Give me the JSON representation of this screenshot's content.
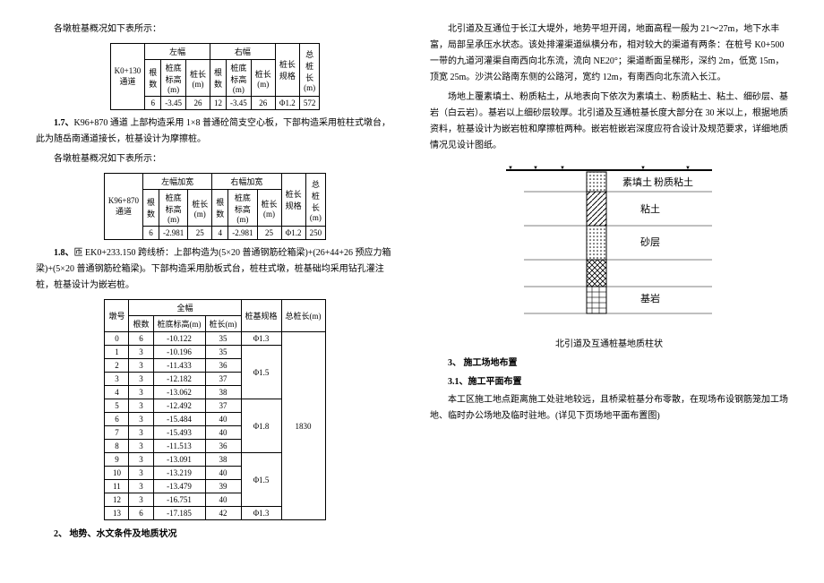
{
  "col1": {
    "intro1": "各墩桩基概况如下表所示：",
    "t1": {
      "row_label": "K0+130\n通道",
      "g1": "左幅",
      "g2": "右幅",
      "g3_a": "桩长\n规格",
      "g3_b": "总\n桩\n长\n(m)",
      "h1": "根\n数",
      "h2": "桩底\n标高\n(m)",
      "h3": "桩长\n(m)",
      "h4": "根\n数",
      "h5": "桩底\n标高\n(m)",
      "h6": "桩长\n(m)",
      "d1": "6",
      "d2": "-3.45",
      "d3": "26",
      "d4": "12",
      "d5": "-3.45",
      "d6": "26",
      "d7": "Φ1.2",
      "d8": "572"
    },
    "p17": "1.7、K96+870 通道 上部构造采用 1×8 普通砼简支空心板，下部构造采用桩柱式墩台，此为随岳南通道接长，桩基设计为摩擦桩。",
    "intro2": "各墩桩基概况如下表所示：",
    "t2": {
      "row_label": "K96+870\n通道",
      "g1": "左幅加宽",
      "g2": "右幅加宽",
      "g3_a": "桩长\n规格",
      "g3_b": "总\n桩\n长\n(m)",
      "h1": "根\n数",
      "h2": "桩底\n标高\n(m)",
      "h3": "桩长\n(m)",
      "h4": "根\n数",
      "h5": "桩底\n标高\n(m)",
      "h6": "桩长\n(m)",
      "d1": "6",
      "d2": "-2.981",
      "d3": "25",
      "d4": "4",
      "d5": "-2.981",
      "d6": "25",
      "d7": "Φ1.2",
      "d8": "250"
    },
    "p18": "1.8、匝 EK0+233.150 跨线桥：上部构造为(5×20 普通钢筋砼箱梁)+(26+44+26 预应力箱梁)+(5×20 普通钢筋砼箱梁)。下部构造采用肋板式台，桩柱式墩，桩基础均采用钻孔灌注桩，桩基设计为嵌岩桩。",
    "t3": {
      "h_pier": "墩号",
      "h_full": "全幅",
      "h_spec": "桩基规格",
      "h_total": "总桩长(m)",
      "sh1": "根数",
      "sh2": "桩底标高(m)",
      "sh3": "桩长(m)",
      "rows": [
        {
          "p": "0",
          "n": "6",
          "el": "-10.122",
          "len": "35",
          "spec": "Φ1.3"
        },
        {
          "p": "1",
          "n": "3",
          "el": "-10.196",
          "len": "35"
        },
        {
          "p": "2",
          "n": "3",
          "el": "-11.433",
          "len": "36"
        },
        {
          "p": "3",
          "n": "3",
          "el": "-12.182",
          "len": "37"
        },
        {
          "p": "4",
          "n": "3",
          "el": "-13.062",
          "len": "38"
        },
        {
          "p": "5",
          "n": "3",
          "el": "-12.492",
          "len": "37"
        },
        {
          "p": "6",
          "n": "3",
          "el": "-15.484",
          "len": "40"
        },
        {
          "p": "7",
          "n": "3",
          "el": "-15.493",
          "len": "40"
        },
        {
          "p": "8",
          "n": "3",
          "el": "-11.513",
          "len": "36"
        },
        {
          "p": "9",
          "n": "3",
          "el": "-13.091",
          "len": "38"
        },
        {
          "p": "10",
          "n": "3",
          "el": "-13.219",
          "len": "40"
        },
        {
          "p": "11",
          "n": "3",
          "el": "-13.479",
          "len": "39"
        },
        {
          "p": "12",
          "n": "3",
          "el": "-16.751",
          "len": "40"
        },
        {
          "p": "13",
          "n": "6",
          "el": "-17.185",
          "len": "42",
          "spec": "Φ1.3"
        }
      ],
      "group1_spec": "Φ1.5",
      "group2_spec": "Φ1.8",
      "group3_spec": "Φ1.5",
      "total": "1830"
    },
    "sec2": "2、 地势、水文条件及地质状况"
  },
  "col2": {
    "p1": "北引道及互通位于长江大堤外，地势平坦开阔，地面高程一般为 21～27m，地下水丰富，局部呈承压水状态。该处排灌渠道纵横分布，相对较大的渠道有两条：在桩号 K0+500 一带的九道河灌渠自南西向北东流，流向 NE20°；渠道断面呈梯形，深约 2m，低宽 15m，顶宽 25m。沙洪公路南东侧的公路河，宽约 12m，有南西向北东流入长江。",
    "p2": "场地上覆素填土、粉质粘土，从地表向下依次为素填土、粉质粘土、粘土、细砂层、基岩（白云岩）。基岩以上细砂层较厚。北引道及互通桩基长度大部分在 30 米以上，根据地质资料，桩基设计为嵌岩桩和摩擦桩两种。嵌岩桩嵌岩深度应符合设计及规范要求，详细地质情况见设计图纸。",
    "soil": {
      "caption": "北引道及互通桩基地质柱状",
      "l1": "素填土",
      "l2": "粉质粘土",
      "l3": "粘土",
      "l4": "砂层",
      "l5": "基岩"
    },
    "sec3": "3、 施工场地布置",
    "sec31": "3.1、施工平面布置",
    "p3": "本工区施工地点距离施工处驻地较远，且桥梁桩基分布零散，在现场布设钢筋笼加工场地、临时办公场地及临时驻地。(详见下页场地平面布置图)"
  }
}
